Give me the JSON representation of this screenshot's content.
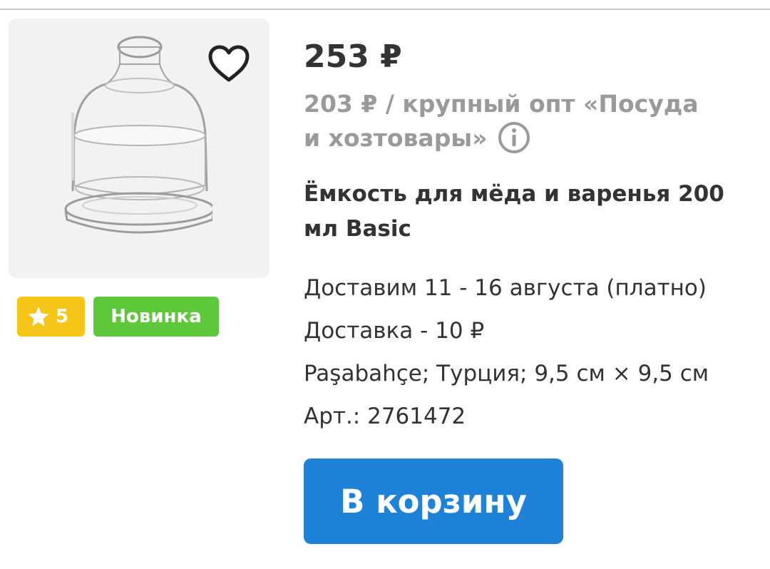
{
  "product": {
    "price": "253 ₽",
    "wholesale_text": "203 ₽ / крупный опт «Посуда и хозтовары»",
    "title": "Ёмкость для мёда и варенья 200 мл Basic",
    "delivery_date": "Доставим 11 - 16 августа (платно)",
    "delivery_cost": "Доставка - 10 ₽",
    "specs": "Paşabahçe; Турция; 9,5 см × 9,5 см",
    "article": "Арт.: 2761472"
  },
  "badges": {
    "rating": "5",
    "new_label": "Новинка",
    "rating_color": "#f5c518",
    "new_color": "#5cc83a"
  },
  "actions": {
    "cart_label": "В корзину",
    "cart_color": "#1e82d8"
  },
  "icons": {
    "favorite": "heart-outline-icon",
    "info": "info-circle-icon",
    "rating": "star-icon"
  }
}
